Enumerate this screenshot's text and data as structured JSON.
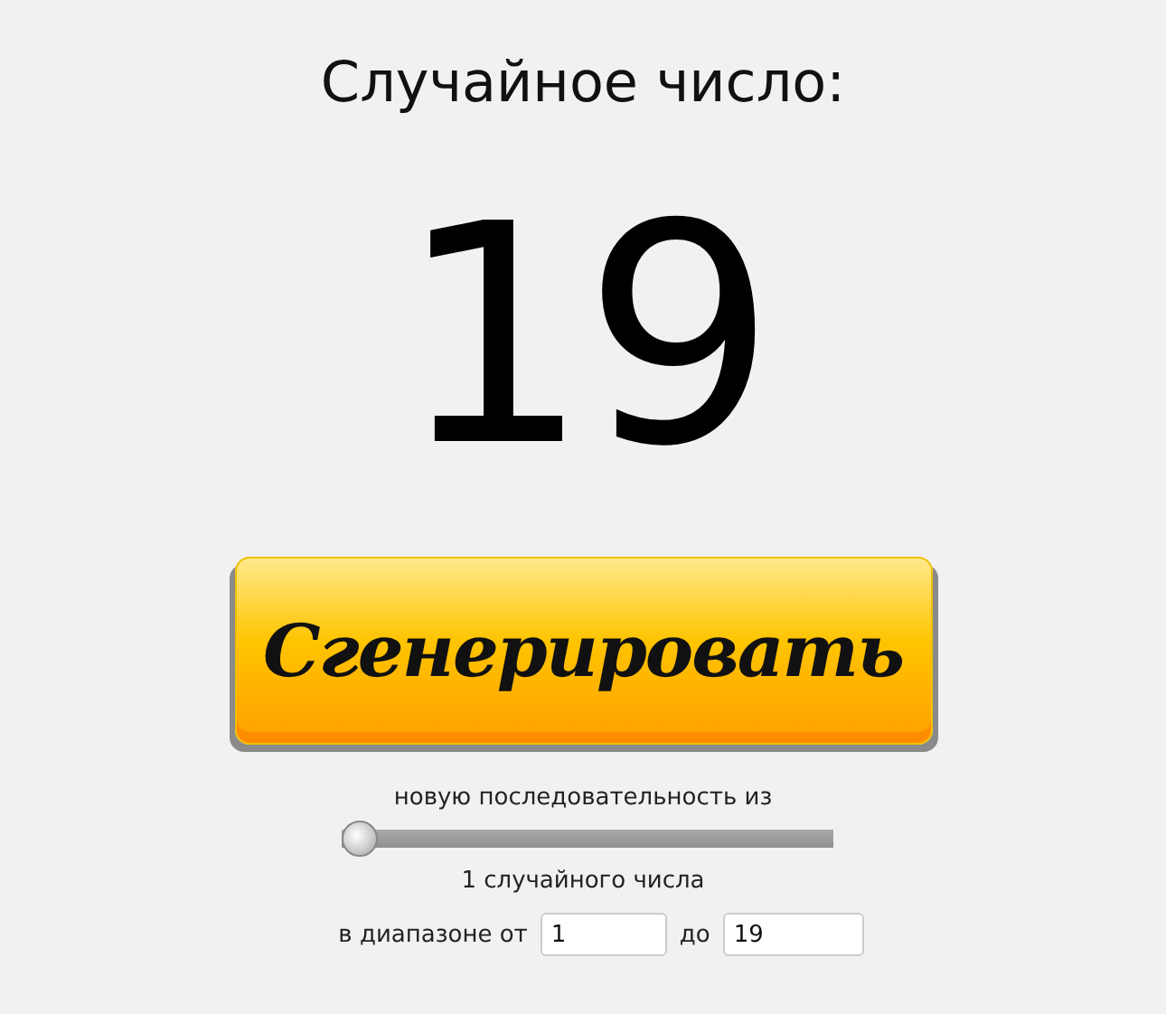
{
  "title": "Случайное число:",
  "result": "19",
  "generate_button": "Сгенерировать",
  "sequence_label": "новую последовательность из",
  "count_slider": {
    "level": 0
  },
  "count_text": "1 случайного числа",
  "range": {
    "from_label": "в диапазоне от",
    "from_value": "1",
    "to_label": "до",
    "to_value": "19"
  }
}
